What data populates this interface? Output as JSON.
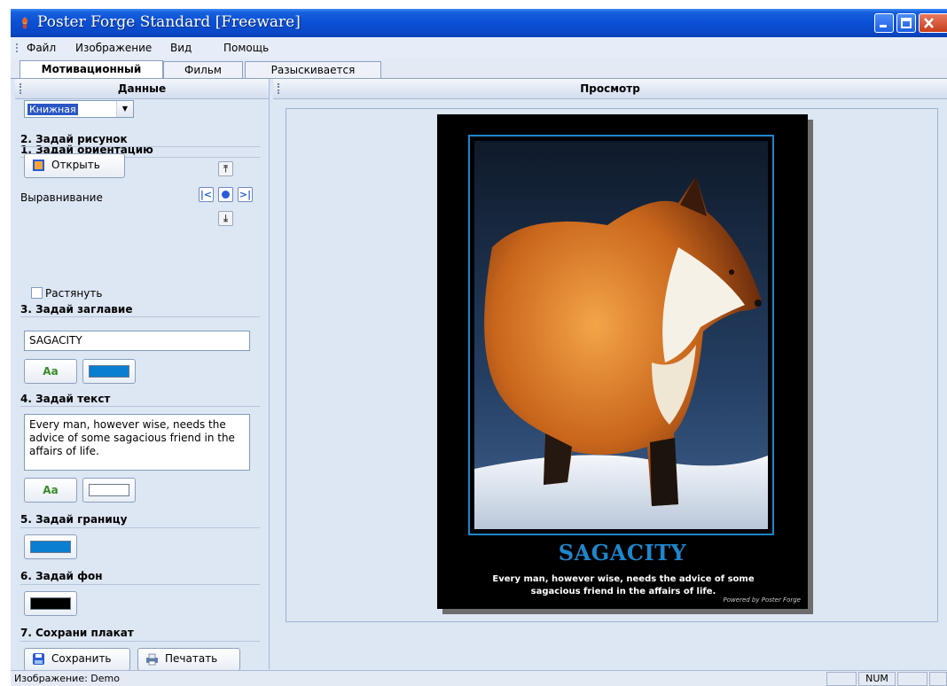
{
  "window": {
    "title": "Poster Forge Standard [Freeware]"
  },
  "menu": [
    "Файл",
    "Изображение",
    "Вид",
    "Помощь"
  ],
  "tabs": [
    "Мотивационный",
    "Фильм",
    "Разыскивается"
  ],
  "left_panel": {
    "header": "Данные",
    "orientation": {
      "title": "1. Задай ориентацию",
      "value": "Книжная"
    },
    "image": {
      "title": "2. Задай рисунок",
      "open_label": "Открыть",
      "align_label": "Выравнивание",
      "stretch_label": "Растянуть"
    },
    "heading": {
      "title": "3. Задай заглавие",
      "value": "SAGACITY",
      "font_label": "Aa",
      "color": "#0a7ed0"
    },
    "text": {
      "title": "4. Задай текст",
      "value": "Every man, however wise, needs the advice of some sagacious friend in the affairs of life.",
      "font_label": "Aa",
      "color": "#ffffff"
    },
    "border": {
      "title": "5. Задай границу",
      "color": "#0a7ed0"
    },
    "background": {
      "title": "6. Задай фон",
      "color": "#000000"
    },
    "save": {
      "title": "7. Сохрани плакат",
      "save_label": "Сохранить",
      "print_label": "Печатать"
    }
  },
  "preview": {
    "header": "Просмотр",
    "poster_title": "SAGACITY",
    "poster_text": "Every man, however wise, needs the advice of some sagacious friend in the affairs of life.",
    "credit": "Powered by Poster Forge"
  },
  "status": {
    "text": "Изображение: Demo",
    "num": "NUM"
  }
}
